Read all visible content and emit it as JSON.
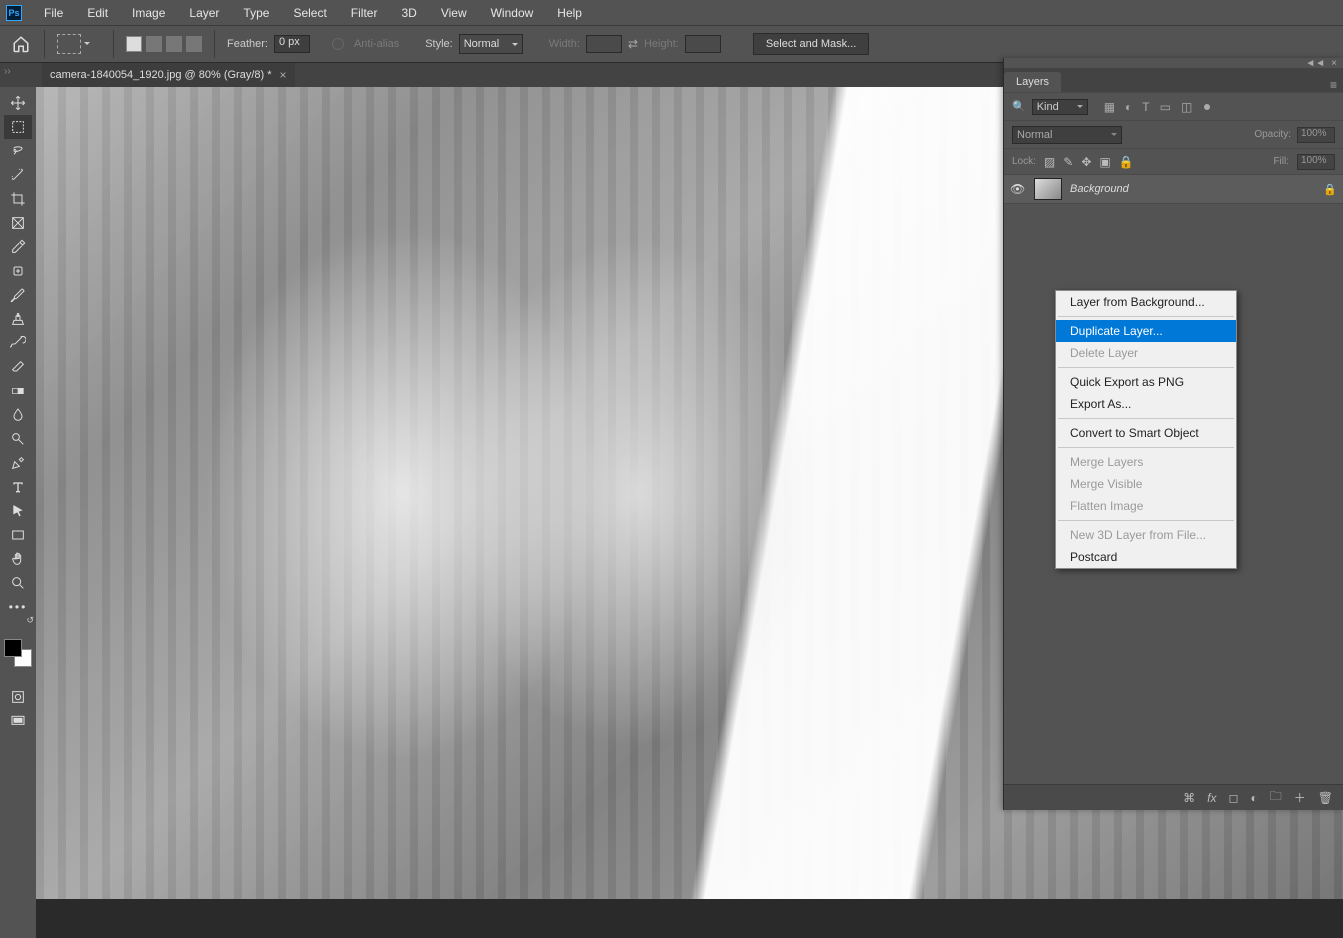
{
  "app": {
    "logo": "Ps"
  },
  "menu": [
    "File",
    "Edit",
    "Image",
    "Layer",
    "Type",
    "Select",
    "Filter",
    "3D",
    "View",
    "Window",
    "Help"
  ],
  "options": {
    "feather_label": "Feather:",
    "feather_value": "0 px",
    "antialias": "Anti-alias",
    "style_label": "Style:",
    "style_value": "Normal",
    "width_label": "Width:",
    "height_label": "Height:",
    "select_mask": "Select and Mask..."
  },
  "tab": {
    "title": "camera-1840054_1920.jpg @ 80% (Gray/8) *"
  },
  "tools": [
    "move",
    "marquee",
    "lasso",
    "wand",
    "crop",
    "frame",
    "eyedropper",
    "healing",
    "brush",
    "clone",
    "history-brush",
    "eraser",
    "gradient",
    "blur",
    "dodge",
    "pen",
    "type",
    "path-select",
    "rectangle",
    "hand",
    "zoom"
  ],
  "layers": {
    "tab": "Layers",
    "kind": "Kind",
    "blend": "Normal",
    "opacity_label": "Opacity:",
    "opacity_value": "100%",
    "lock_label": "Lock:",
    "fill_label": "Fill:",
    "fill_value": "100%",
    "layer_name": "Background"
  },
  "context": {
    "items": [
      {
        "label": "Layer from Background...",
        "enabled": true
      },
      {
        "sep": true
      },
      {
        "label": "Duplicate Layer...",
        "enabled": true,
        "highlight": true
      },
      {
        "label": "Delete Layer",
        "enabled": false
      },
      {
        "sep": true
      },
      {
        "label": "Quick Export as PNG",
        "enabled": true
      },
      {
        "label": "Export As...",
        "enabled": true
      },
      {
        "sep": true
      },
      {
        "label": "Convert to Smart Object",
        "enabled": true
      },
      {
        "sep": true
      },
      {
        "label": "Merge Layers",
        "enabled": false
      },
      {
        "label": "Merge Visible",
        "enabled": false
      },
      {
        "label": "Flatten Image",
        "enabled": false
      },
      {
        "sep": true
      },
      {
        "label": "New 3D Layer from File...",
        "enabled": false
      },
      {
        "label": "Postcard",
        "enabled": true
      }
    ]
  }
}
